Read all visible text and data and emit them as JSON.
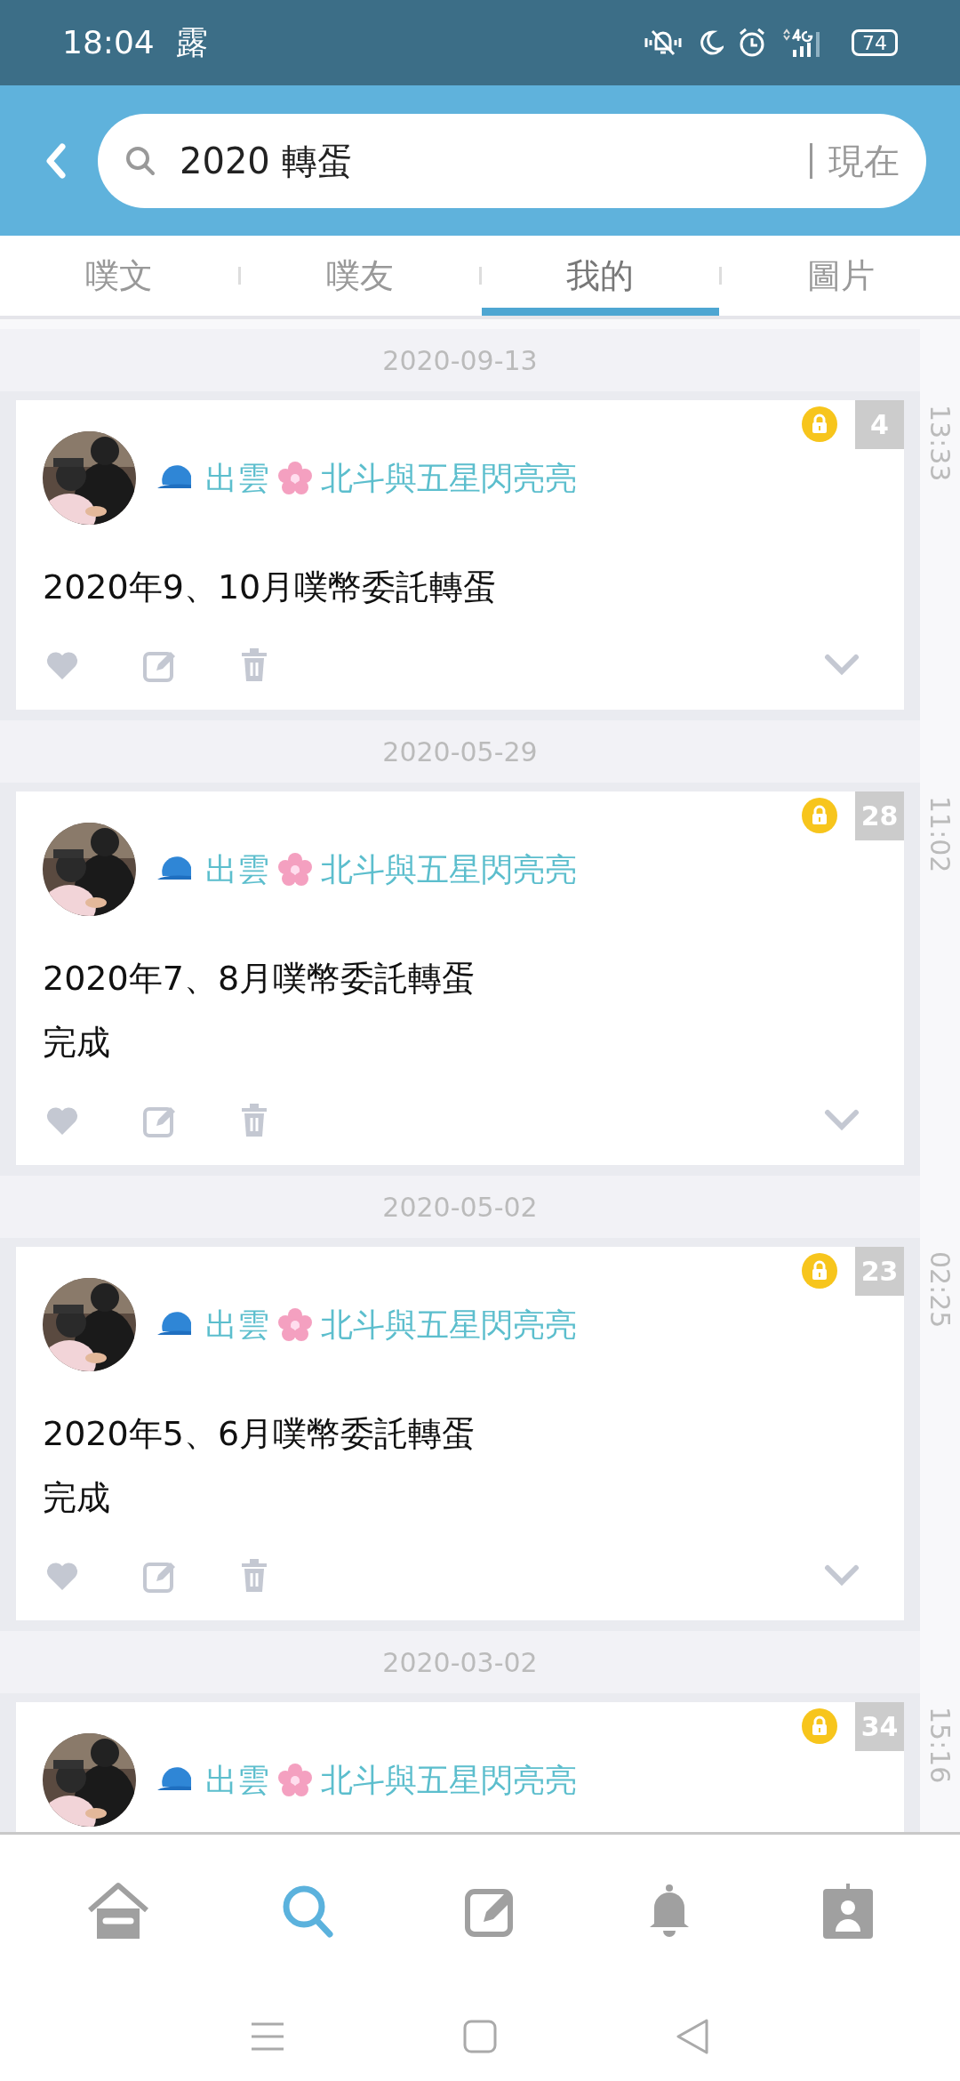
{
  "status_bar": {
    "time": "18:04",
    "app_char": "露",
    "battery": "74"
  },
  "search": {
    "value": "2020 轉蛋",
    "scope": "現在"
  },
  "tabs": [
    {
      "label": "噗文",
      "selected": false
    },
    {
      "label": "噗友",
      "selected": false
    },
    {
      "label": "我的",
      "selected": true
    },
    {
      "label": "圖片",
      "selected": false
    }
  ],
  "posts": [
    {
      "date": "2020-09-13",
      "time": "13:33",
      "author": {
        "part_1": "出雲",
        "part_2": "北斗與五星閃亮亮"
      },
      "private": true,
      "response_count": "4",
      "lines": [
        "2020年9、10月噗幣委託轉蛋"
      ]
    },
    {
      "date": "2020-05-29",
      "time": "11:02",
      "author": {
        "part_1": "出雲",
        "part_2": "北斗與五星閃亮亮"
      },
      "private": true,
      "response_count": "28",
      "lines": [
        "2020年7、8月噗幣委託轉蛋",
        "完成"
      ]
    },
    {
      "date": "2020-05-02",
      "time": "02:25",
      "author": {
        "part_1": "出雲",
        "part_2": "北斗與五星閃亮亮"
      },
      "private": true,
      "response_count": "23",
      "lines": [
        "2020年5、6月噗幣委託轉蛋",
        "完成"
      ]
    },
    {
      "date": "2020-03-02",
      "time": "15:16",
      "author": {
        "part_1": "出雲",
        "part_2": "北斗與五星閃亮亮"
      },
      "private": true,
      "response_count": "34"
    }
  ],
  "bottom_nav": [
    {
      "kind": "home",
      "selected": false
    },
    {
      "kind": "search",
      "selected": true
    },
    {
      "kind": "compose",
      "selected": false
    },
    {
      "kind": "notifications",
      "selected": false
    },
    {
      "kind": "profile",
      "selected": false
    }
  ]
}
